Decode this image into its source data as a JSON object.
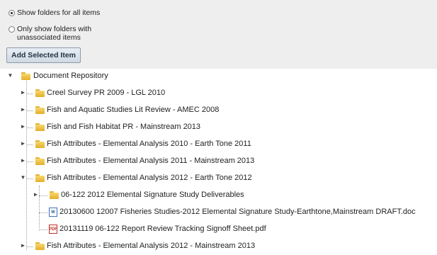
{
  "options": {
    "radio_all": {
      "label": "Show folders for all items",
      "selected": true
    },
    "radio_unassoc": {
      "label_line1": "Only show folders with",
      "label_line2": "unassociated items",
      "selected": false
    },
    "add_button": "Add Selected Item"
  },
  "tree": {
    "root": "Document Repository",
    "children": [
      "Creel Survey PR 2009 - LGL 2010",
      "Fish and Aquatic Studies Lit Review - AMEC 2008",
      "Fish and Fish Habitat PR - Mainstream 2013",
      "Fish Attributes - Elemental Analysis 2010 - Earth Tone 2011",
      "Fish Attributes - Elemental Analysis 2011 - Mainstream 2013",
      "Fish Attributes - Elemental Analysis 2012 - Earth Tone 2012"
    ],
    "expanded_children": {
      "folder": "06-122 2012 Elemental Signature Study Deliverables",
      "word_doc": "20130600 12007 Fisheries Studies-2012 Elemental Signature Study-Earthtone,Mainstream DRAFT.doc",
      "pdf_doc": "20131119 06-122 Report Review Tracking Signoff Sheet.pdf"
    },
    "last_child": "Fish Attributes - Elemental Analysis 2012 - Mainstream 2013",
    "icons": {
      "folder": "folder-icon",
      "word": "word-doc-icon",
      "pdf": "pdf-icon"
    }
  }
}
